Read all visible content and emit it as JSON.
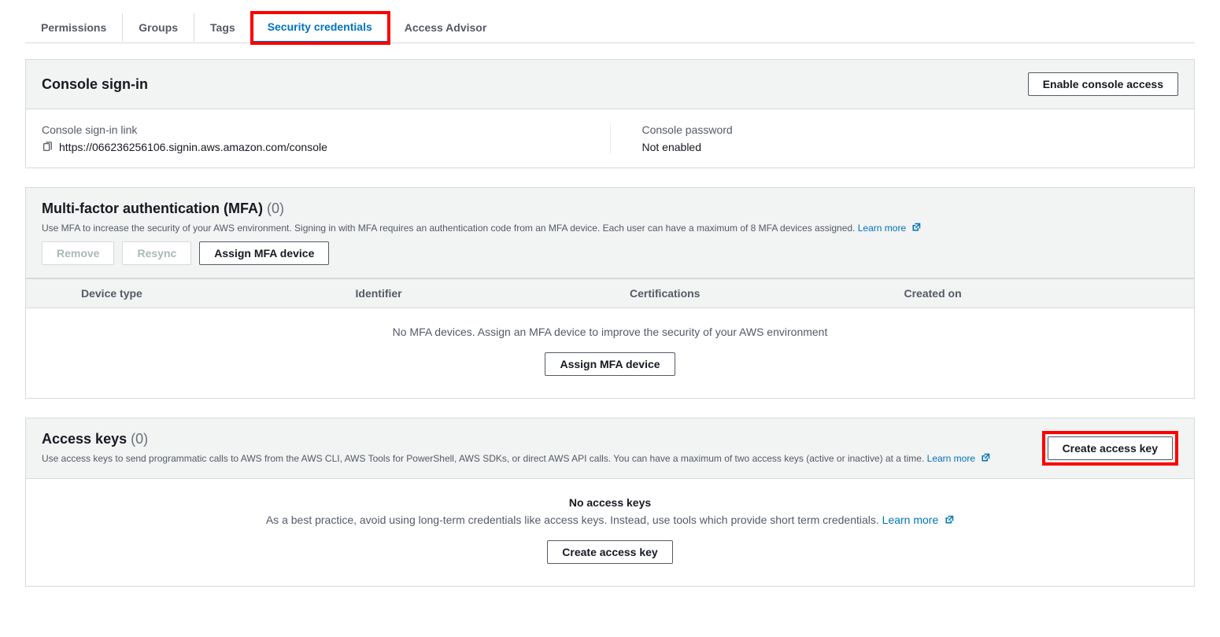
{
  "tabs": [
    {
      "label": "Permissions"
    },
    {
      "label": "Groups"
    },
    {
      "label": "Tags"
    },
    {
      "label": "Security credentials"
    },
    {
      "label": "Access Advisor"
    }
  ],
  "console_signin": {
    "title": "Console sign-in",
    "enable_btn": "Enable console access",
    "link_label": "Console sign-in link",
    "link_value": "https://066236256106.signin.aws.amazon.com/console",
    "password_label": "Console password",
    "password_value": "Not enabled"
  },
  "mfa": {
    "title": "Multi-factor authentication (MFA)",
    "count": "(0)",
    "description": "Use MFA to increase the security of your AWS environment. Signing in with MFA requires an authentication code from an MFA device. Each user can have a maximum of 8 MFA devices assigned.",
    "learn_more": "Learn more",
    "remove_btn": "Remove",
    "resync_btn": "Resync",
    "assign_btn": "Assign MFA device",
    "columns": {
      "device_type": "Device type",
      "identifier": "Identifier",
      "certifications": "Certifications",
      "created_on": "Created on"
    },
    "empty_msg": "No MFA devices. Assign an MFA device to improve the security of your AWS environment",
    "empty_btn": "Assign MFA device"
  },
  "access_keys": {
    "title": "Access keys",
    "count": "(0)",
    "description": "Use access keys to send programmatic calls to AWS from the AWS CLI, AWS Tools for PowerShell, AWS SDKs, or direct AWS API calls. You can have a maximum of two access keys (active or inactive) at a time.",
    "learn_more": "Learn more",
    "create_btn": "Create access key",
    "empty_title": "No access keys",
    "empty_msg_prefix": "As a best practice, avoid using long-term credentials like access keys. Instead, use tools which provide short term credentials.",
    "empty_btn": "Create access key"
  }
}
